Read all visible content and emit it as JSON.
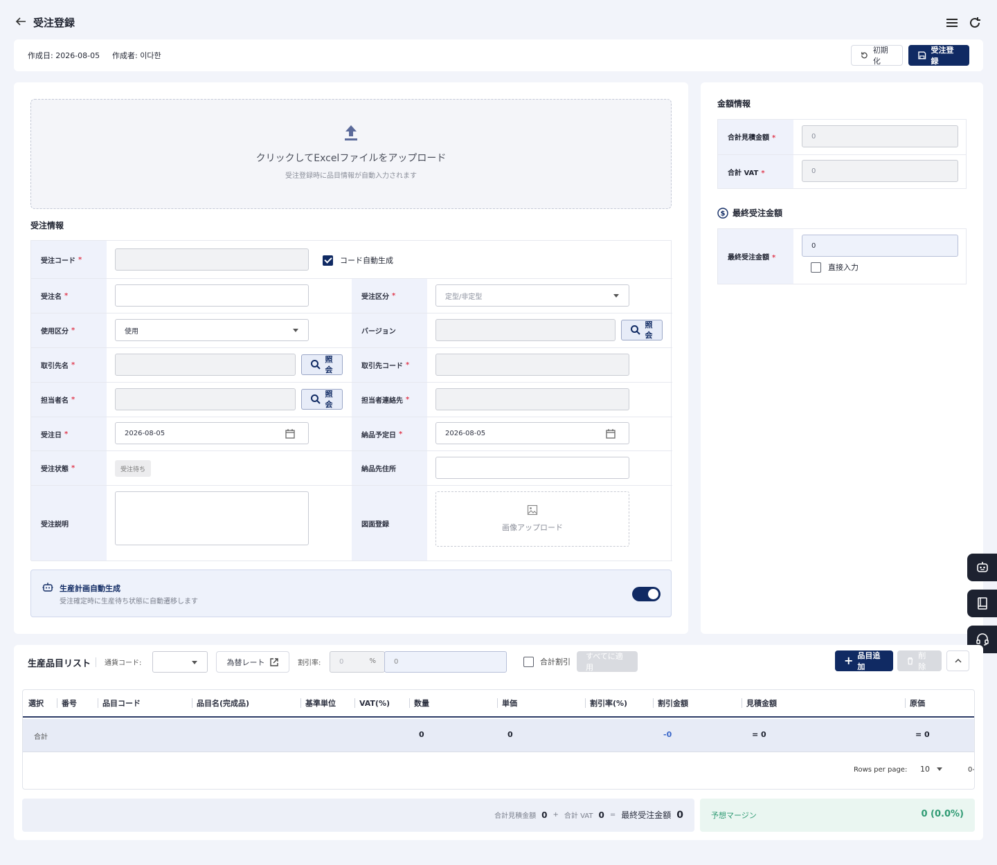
{
  "header": {
    "title": "受注登録",
    "back_icon": "arrow-left-icon",
    "menu_icon": "hamburger-icon",
    "refresh_icon": "refresh-icon"
  },
  "infobar": {
    "created_date": "作成日: 2026-08-05",
    "author": "作成者: 이다한",
    "reset_label": "初期化",
    "submit_label": "受注登録"
  },
  "upload": {
    "title": "クリックしてExcelファイルをアップロード",
    "subtitle": "受注登録時に品目情報が自動入力されます"
  },
  "order_info": {
    "section_title": "受注情報",
    "order_code_label": "受注コード",
    "auto_code_label": "コード自動生成",
    "order_name_label": "受注名",
    "order_type_label": "受注区分",
    "order_type_placeholder": "定型/非定型",
    "usage_label": "使用区分",
    "usage_value": "使用",
    "version_label": "バージョン",
    "search_label": "照会",
    "client_name_label": "取引先名",
    "client_code_label": "取引先コード",
    "manager_name_label": "担当者名",
    "manager_contact_label": "担当者連絡先",
    "order_date_label": "受注日",
    "order_date_value": "2026-08-05",
    "delivery_date_label": "納品予定日",
    "delivery_date_value": "2026-08-05",
    "order_status_label": "受注状態",
    "order_status_value": "受注待ち",
    "delivery_address_label": "納品先住所",
    "description_label": "受注説明",
    "drawing_label": "図面登録",
    "image_upload_label": "画像アップロード"
  },
  "auto_plan": {
    "title": "生産計画自動生成",
    "subtitle": "受注確定時に生産待ち状態に自動遷移します",
    "enabled": true
  },
  "amount_info": {
    "section_title": "金額情報",
    "total_estimate_label": "合計見積金額",
    "total_estimate_value": "0",
    "total_vat_label": "合計 VAT",
    "total_vat_value": "0",
    "final_section_title": "最終受注金額",
    "final_amount_label": "最終受注金額",
    "final_amount_value": "0",
    "direct_input_label": "直接入力"
  },
  "product_list": {
    "title": "生産品目リスト",
    "currency_label": "通貨コード:",
    "exchange_rate_label": "為替レート",
    "discount_rate_label": "割引率:",
    "discount_pct_placeholder": "0",
    "pct_symbol": "%",
    "discount_amount_placeholder": "0",
    "total_discount_label": "合計割引",
    "apply_all_label": "すべてに適用",
    "add_item_label": "品目追加",
    "delete_label": "削除",
    "columns": [
      "選択",
      "番号",
      "品目コード",
      "品目名(完成品)",
      "基準単位",
      "VAT(%)",
      "数量",
      "単価",
      "割引率(%)",
      "割引金額",
      "見積金額",
      "原価"
    ],
    "summary_label": "合計",
    "summary_qty": "0",
    "summary_unit_price": "0",
    "summary_discount": "-0",
    "summary_estimate": "= 0",
    "summary_cost": "= 0",
    "rows_per_page_label": "Rows per page:",
    "rows_per_page_value": "10",
    "page_range": "0-"
  },
  "footer": {
    "total_estimate_label": "合計見積金額",
    "total_estimate_value": "0",
    "plus": "+",
    "total_vat_label": "合計 VAT",
    "total_vat_value": "0",
    "equals": "=",
    "final_label": "最終受注金額",
    "final_value": "0",
    "margin_label": "予想マージン",
    "margin_value": "0 (0.0%)"
  },
  "side_buttons": [
    "robot-icon",
    "book-icon",
    "headset-icon"
  ]
}
